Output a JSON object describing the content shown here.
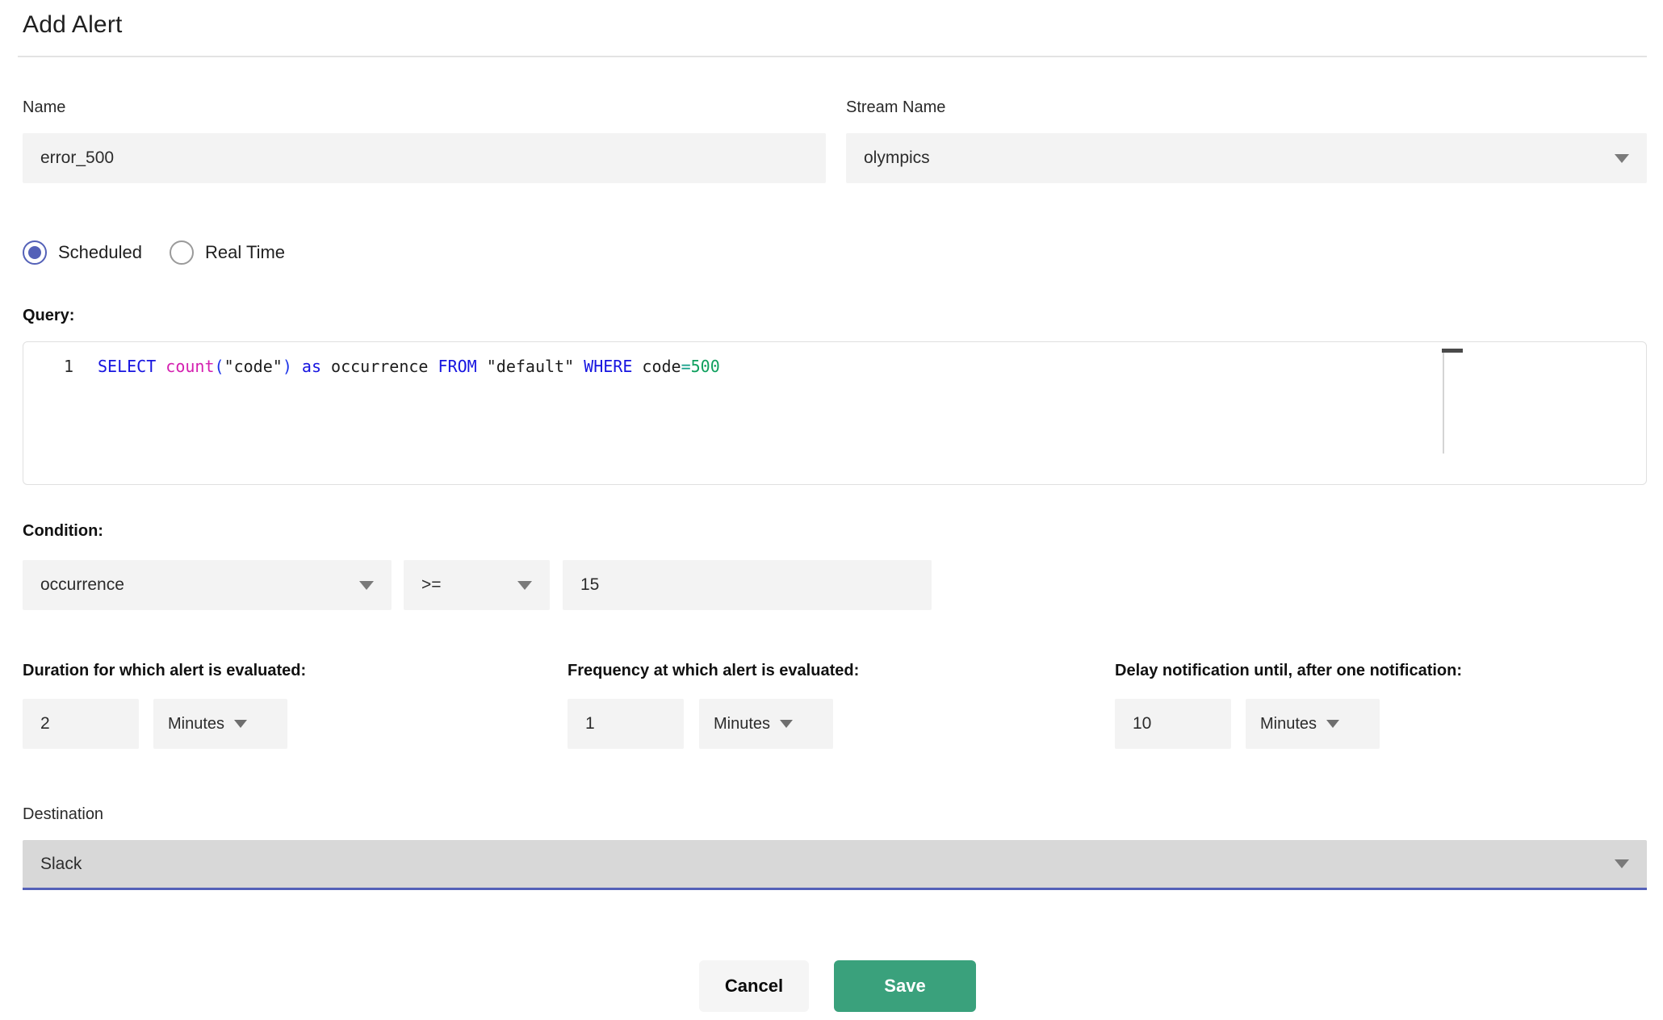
{
  "dialog": {
    "title": "Add Alert"
  },
  "name_field": {
    "label": "Name",
    "value": "error_500",
    "placeholder": ""
  },
  "stream_field": {
    "label": "Stream Name",
    "value": "olympics"
  },
  "alert_type": {
    "options": [
      {
        "label": "Scheduled",
        "selected": true
      },
      {
        "label": "Real Time",
        "selected": false
      }
    ]
  },
  "query": {
    "label": "Query:",
    "line_number": "1",
    "sql": "SELECT count(\"code\") as occurrence FROM \"default\" WHERE code=500",
    "tokens": {
      "select": "SELECT",
      "count": "count",
      "open_paren": "(",
      "code_str": "\"code\"",
      "close_paren": ")",
      "as": "as",
      "occurrence": "occurrence",
      "from": "FROM",
      "default_str": "\"default\"",
      "where": "WHERE",
      "code": "code",
      "equals": "=",
      "number": "500"
    }
  },
  "condition": {
    "label": "Condition:",
    "column": "occurrence",
    "operator": ">=",
    "value": "15"
  },
  "duration": {
    "label": "Duration for which alert is evaluated:",
    "value": "2",
    "unit": "Minutes"
  },
  "frequency": {
    "label": "Frequency at which alert is evaluated:",
    "value": "1",
    "unit": "Minutes"
  },
  "delay": {
    "label": "Delay notification until, after one notification:",
    "value": "10",
    "unit": "Minutes"
  },
  "destination": {
    "label": "Destination",
    "value": "Slack"
  },
  "footer": {
    "cancel_label": "Cancel",
    "save_label": "Save"
  },
  "colors": {
    "accent_indigo": "#5461b8",
    "save_green": "#3aa17c",
    "field_gray": "#f3f3f3",
    "destination_gray": "#d8d8d8",
    "sql_keyword_blue": "#1614e0",
    "sql_function_magenta": "#d420b0",
    "sql_operator_teal": "#129e87",
    "sql_number_green": "#0fa05e"
  },
  "icons": {
    "dropdown": "chevron-down-icon"
  }
}
